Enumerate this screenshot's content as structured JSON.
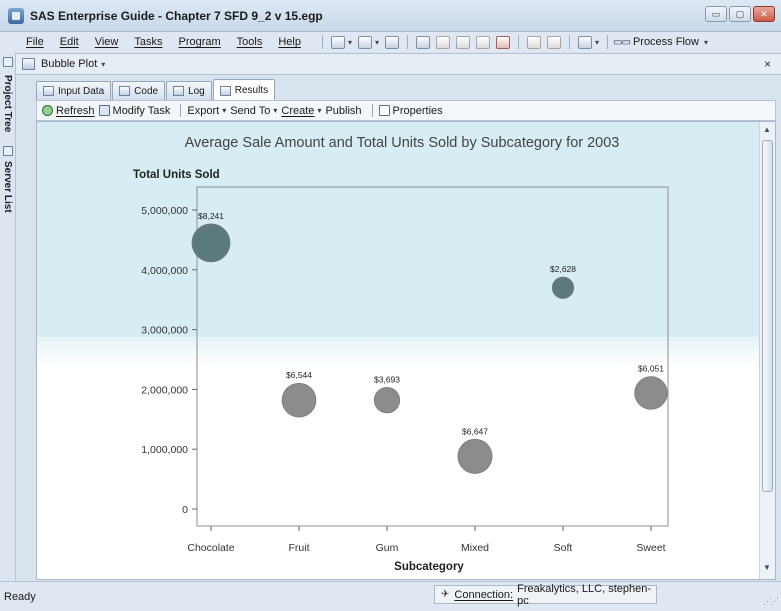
{
  "window": {
    "title": "SAS Enterprise Guide - Chapter 7 SFD 9_2 v 15.egp",
    "controls": [
      "minimize",
      "maximize",
      "close"
    ]
  },
  "menu": {
    "items": [
      "File",
      "Edit",
      "View",
      "Tasks",
      "Program",
      "Tools",
      "Help"
    ],
    "process_flow_label": "Process Flow"
  },
  "document": {
    "title": "Bubble Plot",
    "close_glyph": "×"
  },
  "side_tabs": [
    "Project Tree",
    "Server List"
  ],
  "tabs": [
    {
      "label": "Input Data",
      "active": false
    },
    {
      "label": "Code",
      "active": false
    },
    {
      "label": "Log",
      "active": false
    },
    {
      "label": "Results",
      "active": true
    }
  ],
  "actions": {
    "refresh": "Refresh",
    "modify_task": "Modify Task",
    "export": "Export",
    "send_to": "Send To",
    "create": "Create",
    "publish": "Publish",
    "properties": "Properties"
  },
  "status": {
    "text": "Ready",
    "connection_label": "Connection:",
    "connection_value": "Freakalytics, LLC, stephen-pc"
  },
  "colors": {
    "bubble_highlighted": "#5b7a7d",
    "bubble_default": "#8c8c8c",
    "band": "#d6edf3"
  },
  "chart_data": {
    "type": "bubble",
    "title": "Average Sale Amount and Total Units Sold by Subcategory for 2003",
    "xlabel": "Subcategory",
    "ylabel": "Total Units Sold",
    "categories": [
      "Chocolate",
      "Fruit",
      "Gum",
      "Mixed",
      "Soft",
      "Sweet"
    ],
    "y": [
      4450000,
      1820000,
      1820000,
      880000,
      3700000,
      1940000
    ],
    "bubble_labels": [
      "$8,241",
      "$6,544",
      "$3,693",
      "$6,647",
      "$2,628",
      "$6,051"
    ],
    "sizes": [
      8241,
      6544,
      3693,
      6647,
      2628,
      6051
    ],
    "ylim": [
      0,
      5000000
    ],
    "yticks": [
      0,
      1000000,
      2000000,
      3000000,
      4000000,
      5000000
    ],
    "ytick_labels": [
      "0",
      "1,000,000",
      "2,000,000",
      "3,000,000",
      "4,000,000",
      "5,000,000"
    ],
    "grid": false
  }
}
